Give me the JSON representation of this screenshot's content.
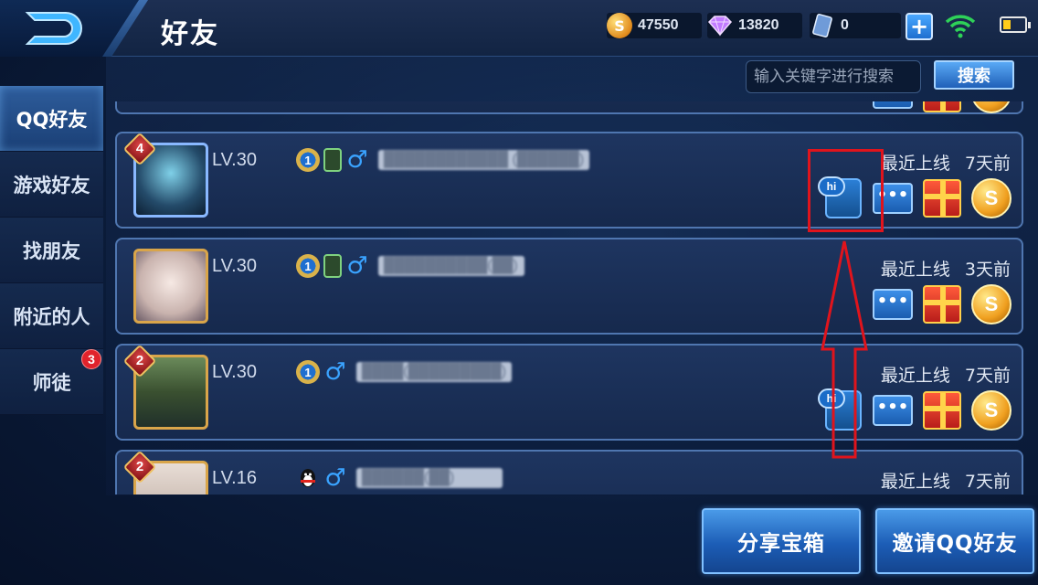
{
  "header": {
    "title": "好友",
    "resources": [
      {
        "icon": "gold-coin-icon",
        "value": "47550"
      },
      {
        "icon": "diamond-icon",
        "value": "13820"
      },
      {
        "icon": "ticket-icon",
        "value": "0"
      }
    ],
    "add_label": "+",
    "battery_level": 0.25
  },
  "search": {
    "placeholder": "输入关键字进行搜索",
    "button_label": "搜索"
  },
  "sidebar": {
    "items": [
      {
        "label": "QQ好友",
        "active": true
      },
      {
        "label": "游戏好友",
        "active": false
      },
      {
        "label": "找朋友",
        "active": false
      },
      {
        "label": "附近的人",
        "active": false
      },
      {
        "label": "师徒",
        "active": false,
        "badge": "3"
      }
    ]
  },
  "friends": [
    {
      "rank": "4",
      "level": "LV.30",
      "star_level": "1",
      "name": "████████████ (██████)",
      "last_online_label": "最近上线",
      "last_online": "7天前",
      "has_hi": true,
      "has_phone": true
    },
    {
      "rank": "",
      "level": "LV.30",
      "star_level": "1",
      "name": "██████████(██)",
      "last_online_label": "最近上线",
      "last_online": "3天前",
      "has_hi": false,
      "has_phone": true
    },
    {
      "rank": "2",
      "level": "LV.30",
      "star_level": "1",
      "name": "████(█████████)",
      "last_online_label": "最近上线",
      "last_online": "7天前",
      "has_hi": true,
      "has_phone": false
    },
    {
      "rank": "2",
      "level": "LV.16",
      "star_level": "",
      "name": "██████(██)",
      "last_online_label": "最近上线",
      "last_online": "7天前",
      "has_hi": false,
      "has_phone": false
    }
  ],
  "action_icons": {
    "hi": "hi",
    "chat": "•••",
    "coin": "S"
  },
  "bottom": {
    "share_label": "分享宝箱",
    "invite_label": "邀请QQ好友"
  },
  "colors": {
    "accent": "#2060b8",
    "highlight": "#e0141c",
    "badge": "#e0232c"
  }
}
